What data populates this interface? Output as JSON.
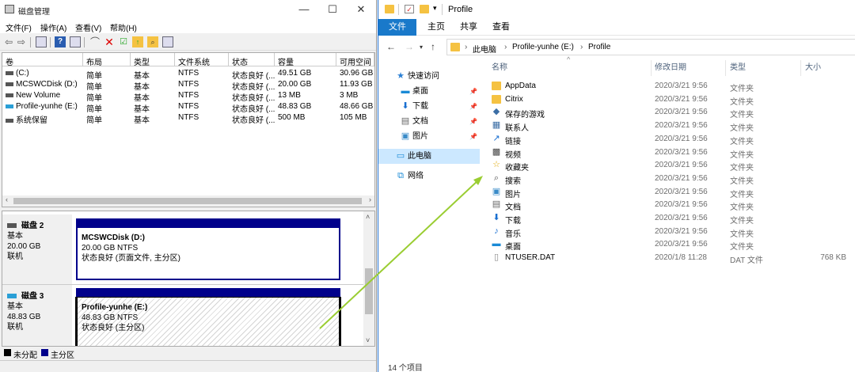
{
  "disk_mgmt": {
    "title": "磁盘管理",
    "menu": [
      "文件(F)",
      "操作(A)",
      "查看(V)",
      "帮助(H)"
    ],
    "columns": [
      "卷",
      "布局",
      "类型",
      "文件系统",
      "状态",
      "容量",
      "可用空间"
    ],
    "volumes": [
      {
        "name": "(C:)",
        "layout": "简单",
        "type": "基本",
        "fs": "NTFS",
        "status": "状态良好 (...",
        "capacity": "49.51 GB",
        "free": "30.96 GB",
        "icon": "disk-gray"
      },
      {
        "name": "MCSWCDisk (D:)",
        "layout": "简单",
        "type": "基本",
        "fs": "NTFS",
        "status": "状态良好 (...",
        "capacity": "20.00 GB",
        "free": "11.93 GB",
        "icon": "disk-gray"
      },
      {
        "name": "New Volume",
        "layout": "简单",
        "type": "基本",
        "fs": "NTFS",
        "status": "状态良好 (...",
        "capacity": "13 MB",
        "free": "3 MB",
        "icon": "disk-gray"
      },
      {
        "name": "Profile-yunhe (E:)",
        "layout": "简单",
        "type": "基本",
        "fs": "NTFS",
        "status": "状态良好 (...",
        "capacity": "48.83 GB",
        "free": "48.66 GB",
        "icon": "disk-blue"
      },
      {
        "name": "系统保留",
        "layout": "简单",
        "type": "基本",
        "fs": "NTFS",
        "status": "状态良好 (...",
        "capacity": "500 MB",
        "free": "105 MB",
        "icon": "disk-gray"
      }
    ],
    "disks": [
      {
        "title": "磁盘 2",
        "kind": "基本",
        "size": "20.00 GB",
        "state": "联机",
        "part_name": "MCSWCDisk   (D:)",
        "part_size": "20.00 GB NTFS",
        "part_status": "状态良好 (页面文件, 主分区)",
        "hatched": false,
        "icon": "disk-gray"
      },
      {
        "title": "磁盘 3",
        "kind": "基本",
        "size": "48.83 GB",
        "state": "联机",
        "part_name": "Profile-yunhe   (E:)",
        "part_size": "48.83 GB NTFS",
        "part_status": "状态良好 (主分区)",
        "hatched": true,
        "icon": "disk-blue"
      }
    ],
    "legend": [
      {
        "label": "未分配",
        "color": "#000000"
      },
      {
        "label": "主分区",
        "color": "#00008b"
      }
    ]
  },
  "explorer": {
    "title": "Profile",
    "ribbon_tabs": [
      "文件",
      "主页",
      "共享",
      "查看"
    ],
    "breadcrumb": [
      "此电脑",
      "Profile-yunhe (E:)",
      "Profile"
    ],
    "nav_items": [
      {
        "label": "快速访问",
        "icon": "star-icon",
        "pinned": false
      },
      {
        "label": "桌面",
        "icon": "desktop-icon",
        "pinned": true
      },
      {
        "label": "下载",
        "icon": "download-icon",
        "pinned": true
      },
      {
        "label": "文档",
        "icon": "document-icon",
        "pinned": true
      },
      {
        "label": "图片",
        "icon": "picture-icon",
        "pinned": true
      },
      {
        "label": "此电脑",
        "icon": "computer-icon",
        "pinned": false
      },
      {
        "label": "网络",
        "icon": "network-icon",
        "pinned": false
      }
    ],
    "columns": [
      "名称",
      "修改日期",
      "类型",
      "大小"
    ],
    "files": [
      {
        "name": "AppData",
        "date": "2020/3/21 9:56",
        "type": "文件夹",
        "size": "",
        "icon": "folder-icon"
      },
      {
        "name": "Citrix",
        "date": "2020/3/21 9:56",
        "type": "文件夹",
        "size": "",
        "icon": "folder-icon"
      },
      {
        "name": "保存的游戏",
        "date": "2020/3/21 9:56",
        "type": "文件夹",
        "size": "",
        "icon": "saved-games-icon"
      },
      {
        "name": "联系人",
        "date": "2020/3/21 9:56",
        "type": "文件夹",
        "size": "",
        "icon": "contacts-icon"
      },
      {
        "name": "链接",
        "date": "2020/3/21 9:56",
        "type": "文件夹",
        "size": "",
        "icon": "link-icon"
      },
      {
        "name": "视频",
        "date": "2020/3/21 9:56",
        "type": "文件夹",
        "size": "",
        "icon": "video-icon"
      },
      {
        "name": "收藏夹",
        "date": "2020/3/21 9:56",
        "type": "文件夹",
        "size": "",
        "icon": "favorites-icon"
      },
      {
        "name": "搜索",
        "date": "2020/3/21 9:56",
        "type": "文件夹",
        "size": "",
        "icon": "search-icon"
      },
      {
        "name": "图片",
        "date": "2020/3/21 9:56",
        "type": "文件夹",
        "size": "",
        "icon": "picture-icon"
      },
      {
        "name": "文档",
        "date": "2020/3/21 9:56",
        "type": "文件夹",
        "size": "",
        "icon": "document-icon"
      },
      {
        "name": "下载",
        "date": "2020/3/21 9:56",
        "type": "文件夹",
        "size": "",
        "icon": "download-icon"
      },
      {
        "name": "音乐",
        "date": "2020/3/21 9:56",
        "type": "文件夹",
        "size": "",
        "icon": "music-icon"
      },
      {
        "name": "桌面",
        "date": "2020/3/21 9:56",
        "type": "文件夹",
        "size": "",
        "icon": "desktop-icon"
      },
      {
        "name": "NTUSER.DAT",
        "date": "2020/1/8 11:28",
        "type": "DAT 文件",
        "size": "768 KB",
        "icon": "file-icon"
      }
    ],
    "item_count": "14 个项目"
  },
  "colors": {
    "partition_header": "#00008b",
    "ribbon_file_tab": "#1979ca",
    "selected_nav": "#cce8ff",
    "connector_arrow": "#9acd32"
  }
}
